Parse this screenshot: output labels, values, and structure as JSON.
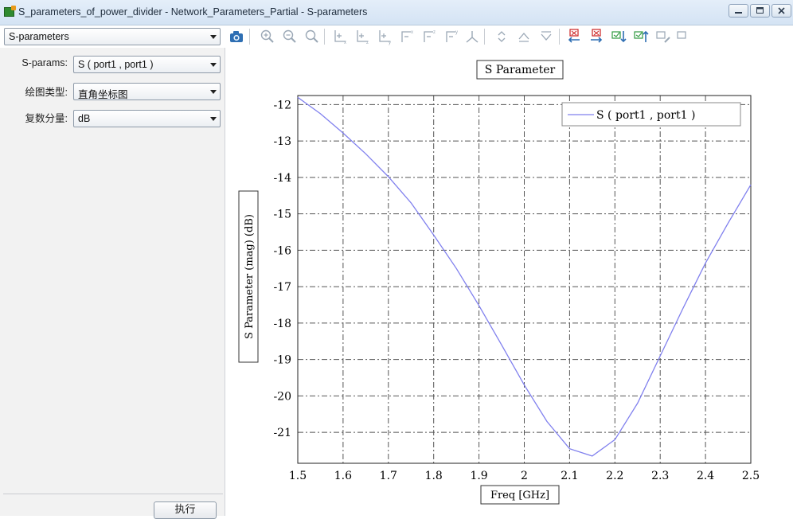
{
  "window": {
    "title": "S_parameters_of_power_divider - Network_Parameters_Partial - S-parameters"
  },
  "result_selector": {
    "value": "S-parameters"
  },
  "toolbar": {
    "icons": [
      "camera-icon",
      "zoom-in-icon",
      "zoom-out-icon",
      "zoom-fit-icon",
      "axis-x-icon",
      "axis-z-icon",
      "axis-y-icon",
      "view-x-icon",
      "view-z-icon",
      "view-y-icon",
      "axes-3d-icon",
      "collapse-icon",
      "up-icon",
      "down-icon",
      "marker-left-icon",
      "marker-right-icon",
      "marker-down-icon",
      "marker-up-icon",
      "marker-edit-icon",
      "marker-more-icon"
    ]
  },
  "panel": {
    "sparams_label": "S-params:",
    "sparams_value": "S ( port1 , port1 )",
    "plot_type_label": "绘图类型:",
    "plot_type_value": "直角坐标图",
    "complex_label": "复数分量:",
    "complex_value": "dB",
    "execute_label": "执行"
  },
  "colors": {
    "series": "#8080ee",
    "grid": "#555555",
    "accent": "#cc2222"
  },
  "chart_data": {
    "type": "line",
    "title": "S Parameter",
    "xlabel": "Freq [GHz]",
    "ylabel": "S Parameter (mag) (dB)",
    "xlim": [
      1.5,
      2.5
    ],
    "ylim": [
      -21.85,
      -11.75
    ],
    "xticks": [
      1.5,
      1.6,
      1.7,
      1.8,
      1.9,
      2.0,
      2.1,
      2.2,
      2.3,
      2.4,
      2.5
    ],
    "xtick_labels": [
      "1.5",
      "1.6",
      "1.7",
      "1.8",
      "1.9",
      "2",
      "2.1",
      "2.2",
      "2.3",
      "2.4",
      "2.5"
    ],
    "yticks": [
      -12,
      -13,
      -14,
      -15,
      -16,
      -17,
      -18,
      -19,
      -20,
      -21
    ],
    "ytick_labels": [
      "-12",
      "-13",
      "-14",
      "-15",
      "-16",
      "-17",
      "-18",
      "-19",
      "-20",
      "-21"
    ],
    "grid": true,
    "legend_position": "top-right",
    "series": [
      {
        "name": "S ( port1 , port1 )",
        "x": [
          1.5,
          1.55,
          1.6,
          1.65,
          1.7,
          1.75,
          1.8,
          1.85,
          1.9,
          1.95,
          2.0,
          2.05,
          2.1,
          2.15,
          2.2,
          2.25,
          2.3,
          2.35,
          2.4,
          2.45,
          2.5
        ],
        "y": [
          -11.8,
          -12.25,
          -12.78,
          -13.35,
          -13.98,
          -14.7,
          -15.58,
          -16.5,
          -17.52,
          -18.6,
          -19.7,
          -20.7,
          -21.45,
          -21.65,
          -21.2,
          -20.2,
          -18.9,
          -17.6,
          -16.35,
          -15.25,
          -14.2
        ]
      }
    ]
  }
}
